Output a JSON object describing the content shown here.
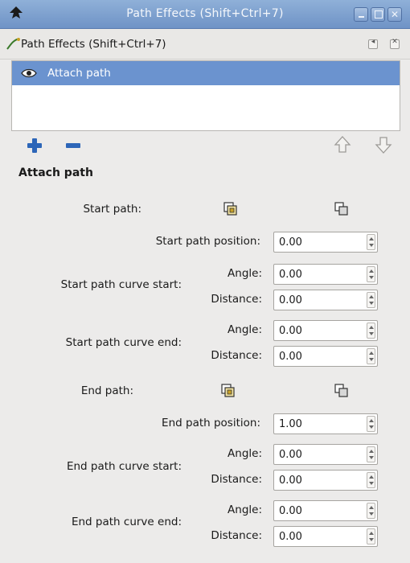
{
  "window": {
    "title": "Path Effects  (Shift+Ctrl+7)"
  },
  "dock": {
    "title": "Path Effects  (Shift+Ctrl+7)"
  },
  "effects_list": {
    "items": [
      {
        "label": "Attach path",
        "selected": true
      }
    ]
  },
  "toolbar": {
    "add_icon": "plus-icon",
    "remove_icon": "minus-icon",
    "up_icon": "arrow-up-icon",
    "down_icon": "arrow-down-icon"
  },
  "section": {
    "title": "Attach path"
  },
  "params": {
    "start_path_label": "Start path:",
    "start_path_position_label": "Start path position:",
    "start_path_position_value": "0.00",
    "start_curve_start_label": "Start path curve start:",
    "start_curve_start_angle": "0.00",
    "start_curve_start_distance": "0.00",
    "start_curve_end_label": "Start path curve end:",
    "start_curve_end_angle": "0.00",
    "start_curve_end_distance": "0.00",
    "end_path_label": "End path:",
    "end_path_position_label": "End path position:",
    "end_path_position_value": "1.00",
    "end_curve_start_label": "End path curve start:",
    "end_curve_start_angle": "0.00",
    "end_curve_start_distance": "0.00",
    "end_curve_end_label": "End path curve end:",
    "end_curve_end_angle": "0.00",
    "end_curve_end_distance": "0.00",
    "angle_label": "Angle:",
    "distance_label": "Distance:"
  },
  "colors": {
    "titlebar": "#7a9dcc",
    "selection": "#6b93cf",
    "accent_icon": "#2d66b8"
  }
}
